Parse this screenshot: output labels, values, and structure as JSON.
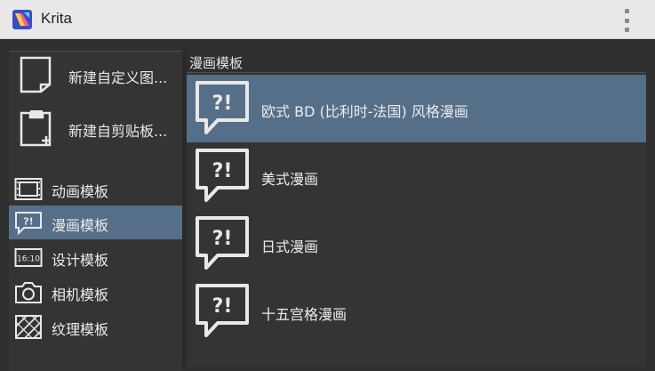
{
  "window": {
    "title": "Krita"
  },
  "sidebar": {
    "big_items": [
      {
        "label": "新建自定义图...",
        "icon": "blank-document-icon"
      },
      {
        "label": "新建自剪贴板...",
        "icon": "clipboard-document-icon"
      }
    ],
    "categories": [
      {
        "label": "动画模板",
        "icon": "film-icon",
        "selected": false
      },
      {
        "label": "漫画模板",
        "icon": "speech-bubble-icon",
        "selected": true
      },
      {
        "label": "设计模板",
        "icon": "aspect-ratio-icon",
        "icon_text": "16:10",
        "selected": false
      },
      {
        "label": "相机模板",
        "icon": "camera-icon",
        "selected": false
      },
      {
        "label": "纹理模板",
        "icon": "texture-icon",
        "selected": false
      }
    ]
  },
  "panel": {
    "header": "漫画模板",
    "templates": [
      {
        "label": "欧式 BD (比利时-法国) 风格漫画",
        "selected": true
      },
      {
        "label": "美式漫画",
        "selected": false
      },
      {
        "label": "日式漫画",
        "selected": false
      },
      {
        "label": "十五宫格漫画",
        "selected": false
      }
    ],
    "bubble_text": "?!"
  },
  "colors": {
    "selection": "#566f89",
    "background": "#2f2f2f",
    "titlebar": "#e8e8e8"
  }
}
